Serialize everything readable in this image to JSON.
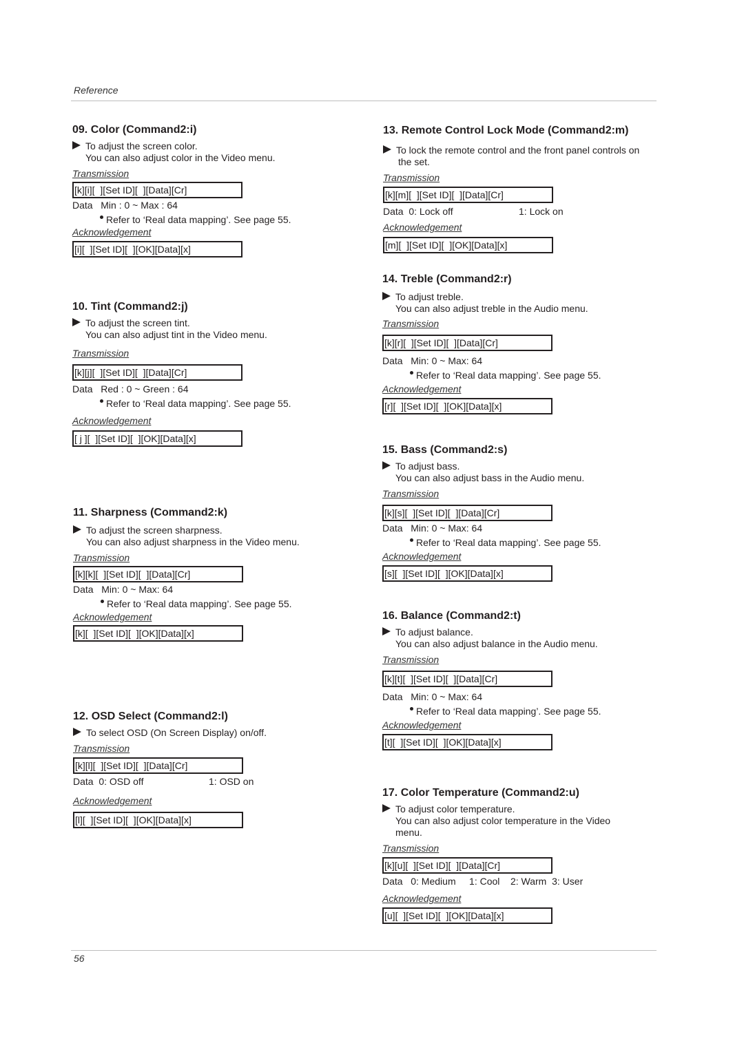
{
  "header": {
    "running_title": "Reference"
  },
  "footer": {
    "page_number": "56"
  },
  "labels": {
    "transmission": "Transmission",
    "acknowledgement": "Acknowledgement"
  },
  "sections": [
    {
      "title": "09. Color (Command2:i)",
      "desc": [
        "To adjust the screen color.",
        "You can also adjust color in the Video menu."
      ],
      "transmission": "[k][i][  ][Set ID][  ][Data][Cr]",
      "data": "Data   Min : 0 ~ Max : 64",
      "note": "Refer to ‘Real data mapping’. See page 55.",
      "ack": "[i][  ][Set ID][  ][OK][Data][x]"
    },
    {
      "title": "10. Tint (Command2:j)",
      "desc": [
        "To adjust the screen tint.",
        "You can also adjust tint in the Video menu."
      ],
      "transmission": "[k][j][  ][Set ID][  ][Data][Cr]",
      "data": "Data   Red : 0 ~ Green : 64",
      "note": "Refer to ‘Real data mapping’. See page 55.",
      "ack": "[ j ][  ][Set ID][  ][OK][Data][x]"
    },
    {
      "title": "11. Sharpness (Command2:k)",
      "desc": [
        "To adjust the screen sharpness.",
        "You can also adjust sharpness in the Video menu."
      ],
      "transmission": "[k][k][  ][Set ID][  ][Data][Cr]",
      "data": "Data   Min: 0 ~ Max: 64",
      "note": "Refer to ‘Real data mapping’. See page 55.",
      "ack": "[k][  ][Set ID][  ][OK][Data][x]"
    },
    {
      "title": "12. OSD Select (Command2:l)",
      "desc": [
        "To select OSD (On Screen Display) on/off."
      ],
      "transmission": "[k][l][  ][Set ID][  ][Data][Cr]",
      "data": "Data  0: OSD off",
      "data_right": "1: OSD on",
      "ack": "[l][  ][Set ID][  ][OK][Data][x]"
    },
    {
      "title": "13. Remote Control Lock Mode (Command2:m)",
      "desc": [
        "To lock the remote control and the front panel controls on",
        "the set."
      ],
      "transmission": "[k][m][  ][Set ID][  ][Data][Cr]",
      "data": "Data  0: Lock off",
      "data_right": "1: Lock on",
      "ack": "[m][  ][Set ID][  ][OK][Data][x]"
    },
    {
      "title": "14. Treble (Command2:r)",
      "desc": [
        "To adjust treble.",
        "You can also adjust treble in the Audio menu."
      ],
      "transmission": "[k][r][  ][Set ID][  ][Data][Cr]",
      "data": "Data   Min: 0 ~ Max: 64",
      "note": "Refer to ‘Real data mapping’. See page 55.",
      "ack": "[r][  ][Set ID][  ][OK][Data][x]"
    },
    {
      "title": "15. Bass (Command2:s)",
      "desc": [
        "To adjust bass.",
        "You can also adjust bass in the Audio menu."
      ],
      "transmission": "[k][s][  ][Set ID][  ][Data][Cr]",
      "data": "Data   Min: 0 ~ Max: 64",
      "note": "Refer to ‘Real data mapping’. See page 55.",
      "ack": "[s][  ][Set ID][  ][OK][Data][x]"
    },
    {
      "title": "16. Balance (Command2:t)",
      "desc": [
        "To adjust balance.",
        "You can also adjust balance in the Audio menu."
      ],
      "transmission": "[k][t][  ][Set ID][  ][Data][Cr]",
      "data": "Data   Min: 0 ~ Max: 64",
      "note": "Refer to ‘Real data mapping’. See page 55.",
      "ack": "[t][  ][Set ID][  ][OK][Data][x]"
    },
    {
      "title": "17. Color Temperature (Command2:u)",
      "desc": [
        "To adjust color temperature.",
        "You can also adjust color temperature in the Video",
        "menu."
      ],
      "transmission": "[k][u][  ][Set ID][  ][Data][Cr]",
      "data": "Data   0: Medium     1: Cool    2: Warm  3: User",
      "ack": "[u][  ][Set ID][  ][OK][Data][x]"
    }
  ]
}
